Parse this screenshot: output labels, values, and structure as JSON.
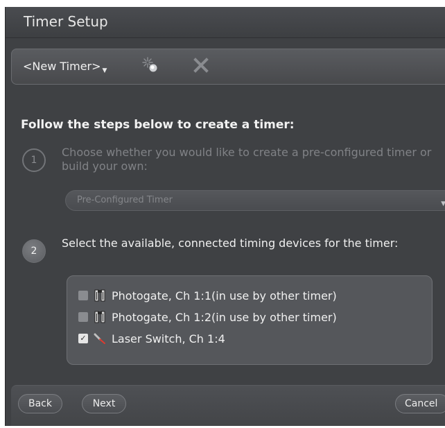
{
  "window": {
    "title": "Timer Setup"
  },
  "toolbar": {
    "timer_select_label": "<New Timer>",
    "new_timer_icon": "sparkle-new-icon",
    "delete_icon": "close-x-icon"
  },
  "main": {
    "heading": "Follow the steps below to create a timer:",
    "steps": [
      {
        "number": "1",
        "text": "Choose whether you would like to create a pre-configured timer or build your own:",
        "enabled": false
      },
      {
        "number": "2",
        "text": "Select the available, connected timing devices for the timer:",
        "enabled": true
      }
    ],
    "timer_type_dropdown": {
      "selected": "Pre-Configured Timer",
      "enabled": false
    },
    "devices": [
      {
        "label": "Photogate, Ch 1:1(in use by other timer)",
        "icon": "photogate-icon",
        "checked": false,
        "disabled": true
      },
      {
        "label": "Photogate, Ch 1:2(in use by other timer)",
        "icon": "photogate-icon",
        "checked": false,
        "disabled": true
      },
      {
        "label": "Laser Switch, Ch 1:4",
        "icon": "laser-switch-icon",
        "checked": true,
        "disabled": false
      }
    ]
  },
  "footer": {
    "back_label": "Back",
    "next_label": "Next",
    "cancel_label": "Cancel"
  },
  "colors": {
    "window_bg": "#3f4144",
    "panel_bg": "#55575b",
    "text_primary": "#f0f0f0",
    "text_disabled": "#808286",
    "laser_red": "#e03a2f"
  }
}
